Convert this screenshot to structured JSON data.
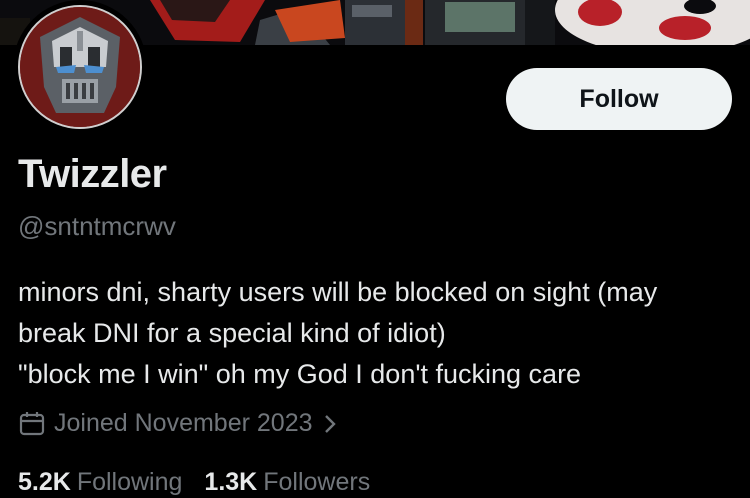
{
  "profile": {
    "display_name": "Twizzler",
    "handle": "@sntntmcrwv",
    "bio_lines": [
      "minors dni, sharty users will be blocked on sight (may",
      "break DNI for a special kind of idiot)",
      "\"block me I win\" oh my God I don't fucking care"
    ],
    "joined": "Joined November 2023"
  },
  "actions": {
    "follow_label": "Follow"
  },
  "stats": {
    "following_count": "5.2K",
    "following_label": "Following",
    "followers_count": "1.3K",
    "followers_label": "Followers"
  },
  "icons": {
    "joined": "calendar-icon",
    "joined_more": "chevron-right-icon"
  },
  "colors": {
    "background": "#000000",
    "text_primary": "#e7e9ea",
    "text_secondary": "#71767b",
    "button_bg": "#eff3f4",
    "button_text": "#0f1419"
  }
}
